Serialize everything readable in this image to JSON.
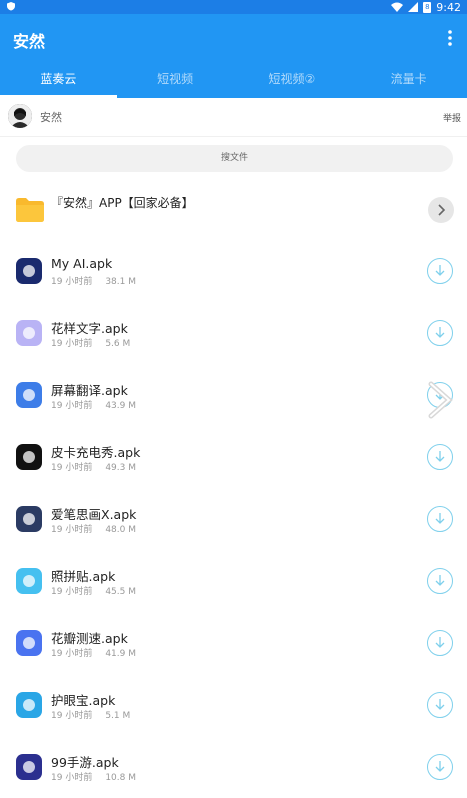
{
  "status": {
    "time": "9:42",
    "battery": "8"
  },
  "appbar": {
    "title": "安然"
  },
  "tabs": [
    {
      "label": "蓝奏云",
      "active": true
    },
    {
      "label": "短视频",
      "active": false
    },
    {
      "label": "短视频②",
      "active": false
    },
    {
      "label": "流量卡",
      "active": false
    }
  ],
  "user": {
    "name": "安然",
    "report_label": "举报"
  },
  "search": {
    "placeholder": "搜文件"
  },
  "folder": {
    "name": "『安然』APP【回家必备】"
  },
  "files": [
    {
      "name": "My AI.apk",
      "time": "19 小时前",
      "size": "38.1 M",
      "icon": "my-ai-icon",
      "color": "#1a2a6e"
    },
    {
      "name": "花样文字.apk",
      "time": "19 小时前",
      "size": "5.6 M",
      "icon": "fancy-text-icon",
      "color": "#b9b3f5"
    },
    {
      "name": "屏幕翻译.apk",
      "time": "19 小时前",
      "size": "43.9 M",
      "icon": "screen-translate-icon",
      "color": "#3d7de8"
    },
    {
      "name": "皮卡充电秀.apk",
      "time": "19 小时前",
      "size": "49.3 M",
      "icon": "pika-charge-icon",
      "color": "#111111"
    },
    {
      "name": "爱笔思画X.apk",
      "time": "19 小时前",
      "size": "48.0 M",
      "icon": "ibis-paint-icon",
      "color": "#2b3b63"
    },
    {
      "name": "照拼贴.apk",
      "time": "19 小时前",
      "size": "45.5 M",
      "icon": "photo-collage-icon",
      "color": "#45c0f0"
    },
    {
      "name": "花瓣测速.apk",
      "time": "19 小时前",
      "size": "41.9 M",
      "icon": "petal-speedtest-icon",
      "color": "#4a73f0"
    },
    {
      "name": "护眼宝.apk",
      "time": "19 小时前",
      "size": "5.1 M",
      "icon": "eye-care-icon",
      "color": "#2aa6e6"
    },
    {
      "name": "99手游.apk",
      "time": "19 小时前",
      "size": "10.8 M",
      "icon": "99-games-icon",
      "color": "#2b2f8f"
    }
  ]
}
